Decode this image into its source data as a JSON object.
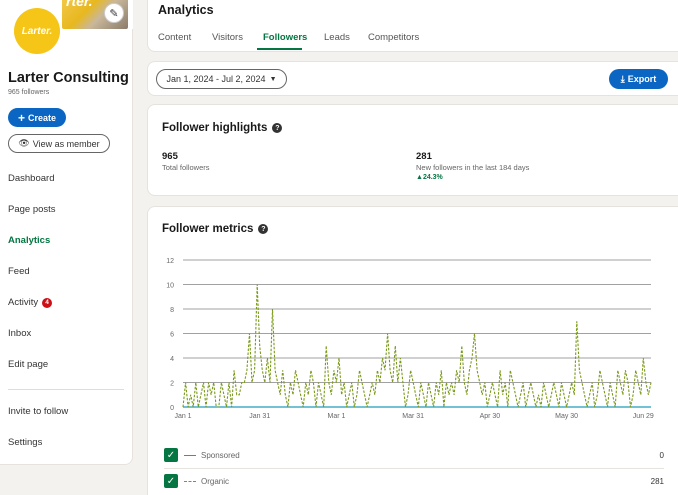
{
  "sidebar": {
    "cover_text": "rter.",
    "logo_text": "Larter.",
    "company_name": "Larter Consulting",
    "followers": "965 followers",
    "create_label": "Create",
    "view_member_label": "View as member",
    "nav": [
      {
        "label": "Dashboard"
      },
      {
        "label": "Page posts"
      },
      {
        "label": "Analytics"
      },
      {
        "label": "Feed"
      },
      {
        "label": "Activity",
        "badge": "4"
      },
      {
        "label": "Inbox"
      },
      {
        "label": "Edit page"
      },
      {
        "label": "Invite to follow"
      },
      {
        "label": "Settings"
      }
    ]
  },
  "header": {
    "title": "Analytics",
    "tabs": [
      "Content",
      "Visitors",
      "Followers",
      "Leads",
      "Competitors"
    ],
    "active_tab": "Followers"
  },
  "toolbar": {
    "date_range": "Jan 1, 2024 - Jul 2, 2024",
    "export_label": "Export"
  },
  "highlights": {
    "title": "Follower highlights",
    "total_value": "965",
    "total_label": "Total followers",
    "new_value": "281",
    "new_label": "New followers in the last 184 days",
    "new_change": "24.3%"
  },
  "metrics": {
    "title": "Follower metrics",
    "legend": [
      {
        "name": "Sponsored",
        "value": "0",
        "color": "#1f9cbb"
      },
      {
        "name": "Organic",
        "value": "281",
        "color": "#7a9a1a"
      }
    ]
  },
  "colors": {
    "accent": "#057642",
    "primary": "#0a66c2",
    "alert": "#cc1016"
  },
  "chart_data": {
    "type": "line",
    "ylim": [
      0,
      12
    ],
    "yticks": [
      0,
      2,
      4,
      6,
      8,
      10,
      12
    ],
    "xticks": [
      "Jan 1",
      "Jan 31",
      "Mar 1",
      "Mar 31",
      "Apr 30",
      "May 30",
      "Jun 29"
    ],
    "days": 184,
    "series": [
      {
        "name": "Sponsored",
        "values": [
          0,
          0,
          0,
          0,
          0,
          0,
          0,
          0,
          0,
          0,
          0,
          0,
          0,
          0,
          0,
          0,
          0,
          0,
          0,
          0,
          0,
          0,
          0,
          0,
          0,
          0,
          0,
          0,
          0,
          0,
          0,
          0,
          0,
          0,
          0,
          0,
          0,
          0,
          0,
          0,
          0,
          0,
          0,
          0,
          0,
          0,
          0,
          0,
          0,
          0,
          0,
          0,
          0,
          0,
          0,
          0,
          0,
          0,
          0,
          0,
          0,
          0,
          0,
          0,
          0,
          0,
          0,
          0,
          0,
          0,
          0,
          0,
          0,
          0,
          0,
          0,
          0,
          0,
          0,
          0,
          0,
          0,
          0,
          0,
          0,
          0,
          0,
          0,
          0,
          0,
          0,
          0,
          0,
          0,
          0,
          0,
          0,
          0,
          0,
          0,
          0,
          0,
          0,
          0,
          0,
          0,
          0,
          0,
          0,
          0,
          0,
          0,
          0,
          0,
          0,
          0,
          0,
          0,
          0,
          0,
          0,
          0,
          0,
          0,
          0,
          0,
          0,
          0,
          0,
          0,
          0,
          0,
          0,
          0,
          0,
          0,
          0,
          0,
          0,
          0,
          0,
          0,
          0,
          0,
          0,
          0,
          0,
          0,
          0,
          0,
          0,
          0,
          0,
          0,
          0,
          0,
          0,
          0,
          0,
          0,
          0,
          0,
          0,
          0,
          0,
          0,
          0,
          0,
          0,
          0,
          0,
          0,
          0,
          0,
          0,
          0,
          0,
          0,
          0,
          0,
          0,
          0,
          0,
          0
        ]
      },
      {
        "name": "Organic",
        "values": [
          0,
          2,
          0,
          1,
          0,
          2,
          0,
          1,
          2,
          0,
          2,
          1,
          2,
          0,
          0,
          2,
          1,
          0,
          2,
          0,
          3,
          1,
          1,
          2,
          2,
          3,
          6,
          2,
          3,
          10,
          5,
          3,
          2,
          4,
          2,
          8,
          3,
          2,
          1,
          3,
          1,
          0,
          2,
          1,
          3,
          2,
          1,
          0,
          2,
          1,
          3,
          2,
          0,
          2,
          1,
          0,
          5,
          2,
          1,
          3,
          2,
          4,
          1,
          2,
          0,
          1,
          2,
          0,
          1,
          3,
          2,
          1,
          0,
          1,
          2,
          1,
          3,
          2,
          4,
          3,
          6,
          3,
          2,
          5,
          2,
          4,
          2,
          0,
          1,
          3,
          2,
          1,
          0,
          2,
          1,
          0,
          2,
          1,
          0,
          2,
          1,
          3,
          0,
          2,
          1,
          2,
          1,
          3,
          2,
          5,
          2,
          1,
          3,
          4,
          6,
          3,
          2,
          1,
          2,
          0,
          1,
          2,
          1,
          0,
          3,
          1,
          2,
          0,
          3,
          2,
          1,
          0,
          1,
          2,
          0,
          1,
          2,
          1,
          0,
          1,
          0,
          2,
          1,
          0,
          1,
          2,
          1,
          0,
          2,
          1,
          0,
          1,
          2,
          1,
          7,
          3,
          2,
          1,
          0,
          1,
          2,
          0,
          1,
          3,
          2,
          1,
          0,
          2,
          1,
          0,
          3,
          2,
          1,
          3,
          2,
          0,
          1,
          3,
          2,
          1,
          4,
          2,
          1,
          2
        ]
      }
    ]
  }
}
